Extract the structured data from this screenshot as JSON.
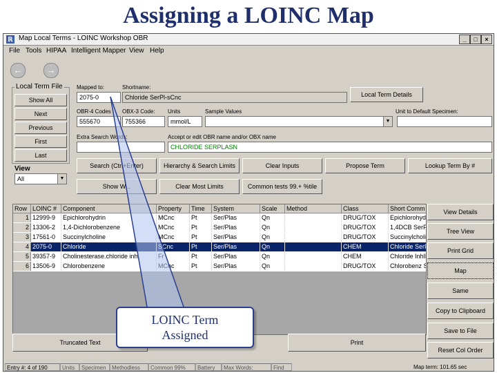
{
  "slide_title": "Assigning a LOINC Map",
  "window": {
    "title": "Map Local Terms - LOINC Workshop OBR",
    "icon": "app-icon",
    "controls": [
      "_",
      "□",
      "×"
    ]
  },
  "menu": [
    "File",
    "Tools",
    "HIPAA",
    "Intelligent Mapper",
    "View",
    "Help"
  ],
  "nav": {
    "back": "back-arrow-icon",
    "forward": "forward-arrow-icon"
  },
  "local_term_file": {
    "title": "Local Term File",
    "buttons": [
      "Show All",
      "Next",
      "Previous",
      "First",
      "Last"
    ]
  },
  "view": {
    "label": "View",
    "value": "All"
  },
  "fields": {
    "mapped_to_label": "Mapped to:",
    "mapped_to_value": "2075-0",
    "shortname_label": "Shortname:",
    "shortname_value": "Chloride SerPl-sCnc",
    "local_term_details": "Local Term Details",
    "obr4_label": "OBR-4 Codes",
    "obr4_value": "555670",
    "obx3_label": "OBX-3 Code:",
    "obx3_value": "755366",
    "units_label": "Units",
    "units_value": "mmol/L",
    "sample_values_label": "Sample Values",
    "sample_values_value": "",
    "unit_default_label": "Unit to Default Specimen:",
    "unit_default_value": "",
    "extra_search_label": "Extra Search Words:",
    "extra_search_value": "",
    "accept_label": "Accept or edit OBR name and/or OBX name",
    "accept_value": "CHLORIDE SERPLASN"
  },
  "action_buttons": {
    "row1": [
      "Search (Ctrl+Enter)",
      "Hierarchy & Search Limits",
      "Clear Inputs",
      "Propose Term",
      "Lookup Term By #"
    ],
    "row2": [
      "Show W...",
      "Clear Most Limits",
      "Common tests 99.+ %tile"
    ]
  },
  "grid": {
    "columns": [
      "Row",
      "LOINC #",
      "Component",
      "Property",
      "Time",
      "System",
      "Scale",
      "Method",
      "Class",
      "Short Comm"
    ],
    "rows": [
      [
        "1",
        "12999-9",
        "Epichlorohydrin",
        "MCnc",
        "Pt",
        "Ser/Plas",
        "Qn",
        "",
        "DRUG/TOX",
        "Epichlorohyd"
      ],
      [
        "2",
        "13306-2",
        "1,4-Dichlorobenzene",
        "MCnc",
        "Pt",
        "Ser/Plas",
        "Qn",
        "",
        "DRUG/TOX",
        "1,4DCB SerP"
      ],
      [
        "3",
        "17561-0",
        "Succinylcholine",
        "MCnc",
        "Pt",
        "Ser/Plas",
        "Qn",
        "",
        "DRUG/TOX",
        "Succinylcholi"
      ],
      [
        "4",
        "2075-0",
        "Chloride",
        "SCnc",
        "Pt",
        "Ser/Plas",
        "Qn",
        "",
        "CHEM",
        "Chloride SerP"
      ],
      [
        "5",
        "39357-9",
        "Cholinesterase.chloride inh",
        "Fr",
        "Pt",
        "Ser/Plas",
        "Qn",
        "",
        "CHEM",
        "Chloride InhIb"
      ],
      [
        "6",
        "13506-9",
        "Chlorobenzene",
        "MCnc",
        "Pt",
        "Ser/Plas",
        "Qn",
        "",
        "DRUG/TOX",
        "Chlorobenz S"
      ]
    ],
    "selected_row": 3
  },
  "side_buttons": [
    "View Details",
    "Tree View",
    "Print Grid",
    "Map",
    "Same",
    "Copy to Clipboard",
    "Save to File",
    "Reset Col Order"
  ],
  "bottom_buttons": [
    "Truncated Text",
    "Print"
  ],
  "status": {
    "entry": "Entry #: 4 of 190",
    "items": [
      "Units",
      "Specimen",
      "Methodless",
      "Common 99%",
      "Battery",
      "Max Words:",
      "Find"
    ],
    "map_term": "Map term: 101.65 sec"
  },
  "callout": {
    "line1": "LOINC Term",
    "line2": "Assigned"
  }
}
